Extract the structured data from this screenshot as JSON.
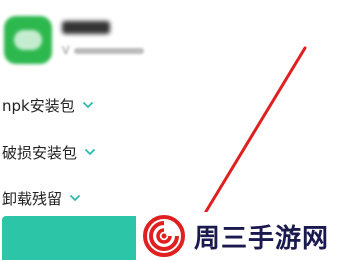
{
  "app": {
    "name": "",
    "version": ""
  },
  "sections": [
    {
      "label": "npk安装包"
    },
    {
      "label": "破损安装包"
    },
    {
      "label": "卸载残留"
    }
  ],
  "install_button": {
    "label": ""
  },
  "watermark": {
    "text": "周三手游网"
  },
  "icons": {
    "section_chevron": "chevron-down-icon",
    "annotation": "red-arrow"
  },
  "colors": {
    "app_icon": "#2db84e",
    "button": "#2dc5a8",
    "chevron": "#2db8b0",
    "arrow": "#e02020",
    "watermark_text": "#1a1a4e",
    "watermark_logo": "#e02020"
  }
}
